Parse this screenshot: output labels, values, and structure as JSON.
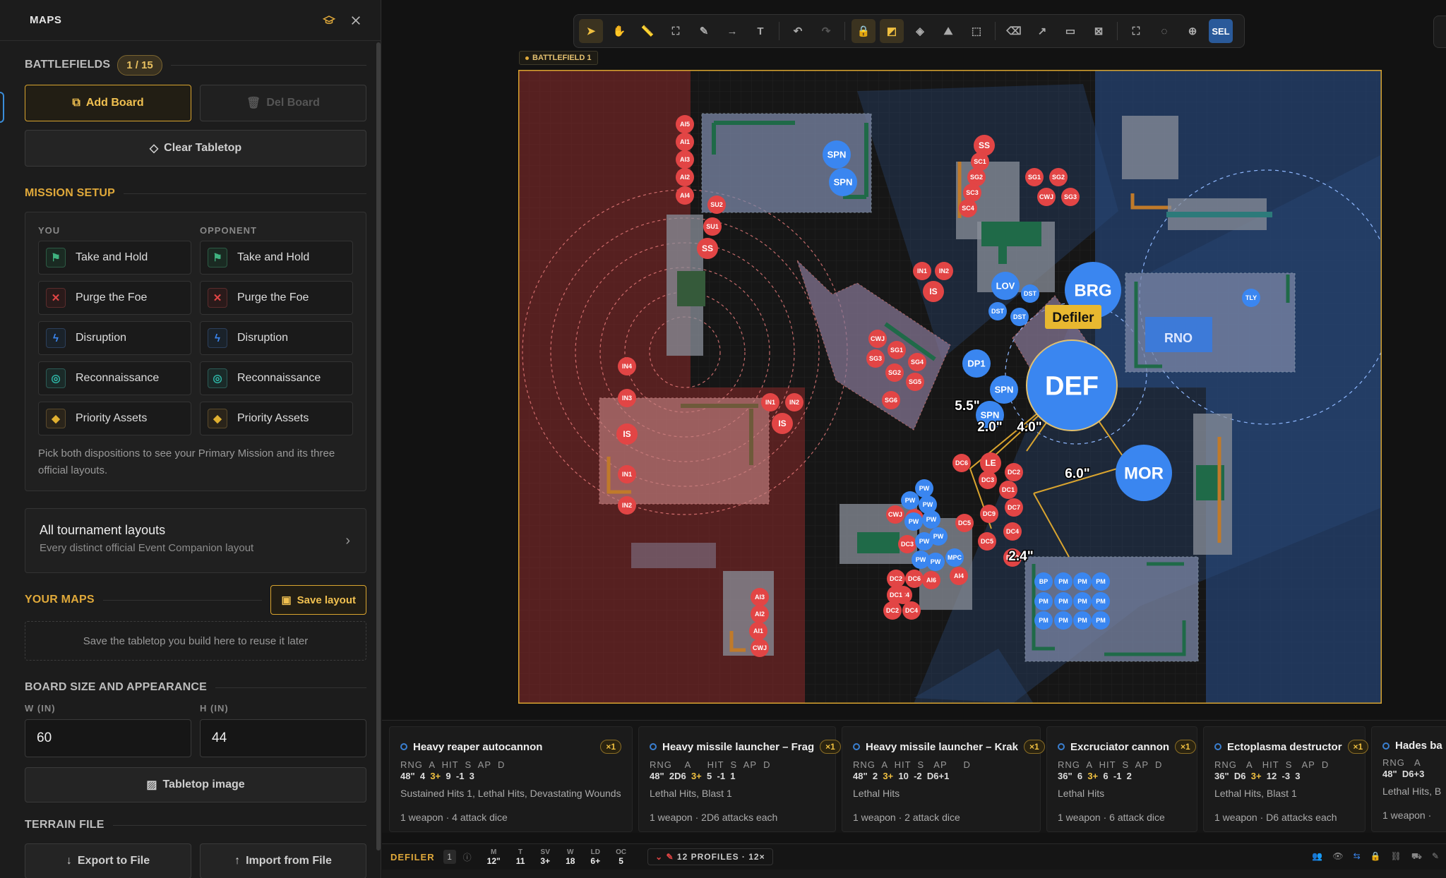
{
  "sidebar": {
    "title": "MAPS",
    "battlefields": {
      "label": "BATTLEFIELDS",
      "count": "1 / 15"
    },
    "add_board": "Add Board",
    "del_board": "Del Board",
    "clear": "Clear Tabletop",
    "mission_setup": "MISSION SETUP",
    "you_label": "YOU",
    "opp_label": "OPPONENT",
    "you": [
      "Take and Hold",
      "Purge the Foe",
      "Disruption",
      "Reconnaissance",
      "Priority Assets"
    ],
    "opponent": [
      "Take and Hold",
      "Purge the Foe",
      "Disruption",
      "Reconnaissance",
      "Priority Assets"
    ],
    "hint": "Pick both dispositions to see your Primary Mission and its three official layouts.",
    "layouts_title": "All tournament layouts",
    "layouts_sub": "Every distinct official Event Companion layout",
    "your_maps": "YOUR MAPS",
    "save_layout": "Save layout",
    "save_hint": "Save the tabletop you build here to reuse it later",
    "board_size": "BOARD SIZE AND APPEARANCE",
    "w_label": "W (IN)",
    "h_label": "H (IN)",
    "w_value": "60",
    "h_value": "44",
    "tabletop_image": "Tabletop image",
    "terrain_file": "TERRAIN FILE",
    "export": "Export to File",
    "import": "Import from File"
  },
  "battlefield_label": "BATTLEFIELD 1",
  "colors": {
    "accent": "#e0a93a",
    "red": "#e24545",
    "blue": "#3a86f0"
  },
  "board": {
    "tooltip": "Defiler",
    "measurements": [
      "5.5\"",
      "2.0\"",
      "4.0\"",
      "6.0\"",
      "2.4\""
    ],
    "big_tokens": {
      "def": "DEF",
      "brg": "BRG",
      "mor": "MOR",
      "rno": "RNO"
    },
    "tokens_red": [
      "AI5",
      "AI1",
      "AI3",
      "AI2",
      "AI4",
      "SU2",
      "SU1",
      "SS",
      "SS",
      "SC1",
      "SG2",
      "SC3",
      "SC4",
      "SG1",
      "SG2",
      "CWJ",
      "SG3",
      "IN1",
      "IN2",
      "IS",
      "CWJ",
      "SG1",
      "SG3",
      "SG4",
      "SG2",
      "SG5",
      "SG6",
      "IN4",
      "IN3",
      "IS",
      "IN1",
      "IN2",
      "IN1",
      "IN2",
      "IS",
      "DC6",
      "LE",
      "DC2",
      "DC3",
      "DC1",
      "DC7",
      "DC9",
      "DC4",
      "DC5",
      "DC2",
      "DC5",
      "CWJ",
      "DC1",
      "DC3",
      "DC2",
      "DC6",
      "DC4",
      "DC2",
      "DC4",
      "AI4",
      "AI6",
      "AI3",
      "AI2",
      "AI1",
      "CWJ",
      "DC1"
    ],
    "tokens_blue": [
      "SPN",
      "SPN",
      "LOV",
      "DST",
      "DST",
      "DST",
      "DP1",
      "SPN",
      "SPN",
      "TLY",
      "PW",
      "PW",
      "PW",
      "PW",
      "PW",
      "PW",
      "PW",
      "PW",
      "PW",
      "MPC",
      "BP",
      "PM",
      "PM",
      "PM",
      "PM",
      "PM",
      "PM",
      "PM",
      "PM",
      "PM",
      "PM",
      "PM"
    ]
  },
  "weapons": [
    {
      "name": "Heavy reaper autocannon",
      "mult": "×1",
      "labels": "RNG  A  HIT  S  AP  D",
      "values": [
        "48\"",
        "4",
        "3+",
        "9",
        "-1",
        "3"
      ],
      "kw": "Sustained Hits 1, Lethal Hits, Devastating Wounds",
      "count": "1 weapon · 4 attack dice"
    },
    {
      "name": "Heavy missile launcher – Frag",
      "mult": "×1",
      "labels": "RNG    A     HIT  S  AP  D",
      "values": [
        "48\"",
        "2D6",
        "3+",
        "5",
        "-1",
        "1"
      ],
      "kw": "Lethal Hits, Blast 1",
      "count": "1 weapon · 2D6 attacks each"
    },
    {
      "name": "Heavy missile launcher – Krak",
      "mult": "×1",
      "labels": "RNG  A  HIT  S   AP     D",
      "values": [
        "48\"",
        "2",
        "3+",
        "10",
        "-2",
        "D6+1"
      ],
      "kw": "Lethal Hits",
      "count": "1 weapon · 2 attack dice"
    },
    {
      "name": "Excruciator cannon",
      "mult": "×1",
      "labels": "RNG  A  HIT  S  AP  D",
      "values": [
        "36\"",
        "6",
        "3+",
        "6",
        "-1",
        "2"
      ],
      "kw": "Lethal Hits",
      "count": "1 weapon · 6 attack dice"
    },
    {
      "name": "Ectoplasma destructor",
      "mult": "×1",
      "labels": "RNG   A   HIT  S   AP  D",
      "values": [
        "36\"",
        "D6",
        "3+",
        "12",
        "-3",
        "3"
      ],
      "kw": "Lethal Hits, Blast 1",
      "count": "1 weapon · D6 attacks each"
    },
    {
      "name": "Hades ba",
      "mult": "",
      "labels": "RNG   A",
      "values": [
        "48\"",
        "D6+3"
      ],
      "kw": "Lethal Hits, B",
      "count": "1 weapon · "
    }
  ],
  "unit": {
    "name": "DEFILER",
    "num": "1",
    "stats": [
      [
        "M",
        "12\""
      ],
      [
        "T",
        "11"
      ],
      [
        "SV",
        "3+"
      ],
      [
        "W",
        "18"
      ],
      [
        "LD",
        "6+"
      ],
      [
        "OC",
        "5"
      ]
    ],
    "profiles": "12 PROFILES · 12×"
  },
  "toolbar": {
    "sel": "SEL"
  }
}
